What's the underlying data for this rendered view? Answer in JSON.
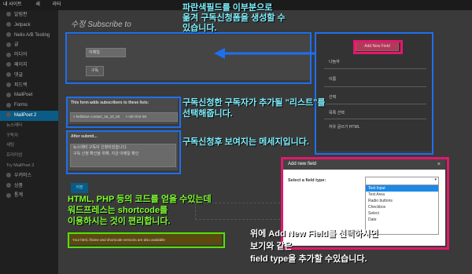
{
  "topbar": {
    "site": "내 사이트",
    "new": "새",
    "extra": "라터"
  },
  "sidebar": {
    "items": [
      {
        "label": "알림판",
        "type": "normal"
      },
      {
        "label": "Jetpack",
        "type": "normal"
      },
      {
        "label": "Nelio A/B Testing",
        "type": "normal"
      },
      {
        "label": "글",
        "type": "normal"
      },
      {
        "label": "미디어",
        "type": "normal"
      },
      {
        "label": "페이지",
        "type": "normal"
      },
      {
        "label": "댓글",
        "type": "normal"
      },
      {
        "label": "피드백",
        "type": "normal"
      },
      {
        "label": "MailPoet",
        "type": "normal"
      },
      {
        "label": "Forms",
        "type": "normal"
      },
      {
        "label": "MailPoet 2",
        "type": "active"
      },
      {
        "label": "뉴스레터",
        "type": "sub"
      },
      {
        "label": "구독자",
        "type": "sub"
      },
      {
        "label": "세팅",
        "type": "sub"
      },
      {
        "label": "프리미엄",
        "type": "sub"
      },
      {
        "label": "Try MailPoet 3",
        "type": "sub"
      },
      {
        "label": "우커머스",
        "type": "normal"
      },
      {
        "label": "상품",
        "type": "normal"
      },
      {
        "label": "통계",
        "type": "normal"
      }
    ]
  },
  "page": {
    "title_prefix": "수정",
    "title_italic": "Subscribe to"
  },
  "form": {
    "email_placeholder": "이메일",
    "subscribe_button": "구독",
    "lists_title": "This form adds subscribers to these lists:",
    "lists_value": "× helloboe contact_16_10_20",
    "lists_value2": "× Info first list",
    "after_submit_title": "After submit...",
    "after_submit_text1": "뉴스레터 구독이 신청되었습니다.",
    "after_submit_text2": "구독 신청 확인을 위해, 지금 이메일 확인",
    "save_button": "저장",
    "shortcode_text": "Your html, iframe and shortcode versions are also available"
  },
  "right_panel": {
    "add_new_field": "Add New Field",
    "items": [
      "나눔자",
      "이름",
      "선택",
      "목록 선택",
      "자유 글쓰기 HTML"
    ]
  },
  "modal": {
    "title": "Add new field",
    "close": "×",
    "label": "Select a field type:",
    "options": [
      "Text Input",
      "Text Area",
      "Radio buttons",
      "Checkbox",
      "Select",
      "Date"
    ]
  },
  "annotations": {
    "a1": [
      "파란색필드를 이부분으로",
      "옮겨 구독신청폼을 생성할 수",
      "있습니다."
    ],
    "a2": [
      "구독신청한 구독자가 추가될 \"리스트\"를",
      "선택해줍니다."
    ],
    "a3": "구독신청후 보여지는 메세지입니다.",
    "a4": [
      "HTML, PHP 등의 코드를 얻을 수있는데",
      "워드프레스는 shortcode를",
      "이용하시는 것이 편리합니다."
    ],
    "a5": [
      "위에 Add New Field를 선택하시면",
      "보기와 같은",
      "field type을 추가할 수있습니다."
    ]
  },
  "colors": {
    "blue_box": "#1e6ff0",
    "green_box": "#55e000",
    "pink_box": "#e0196b",
    "cyan_text": "#7ff0ff"
  }
}
